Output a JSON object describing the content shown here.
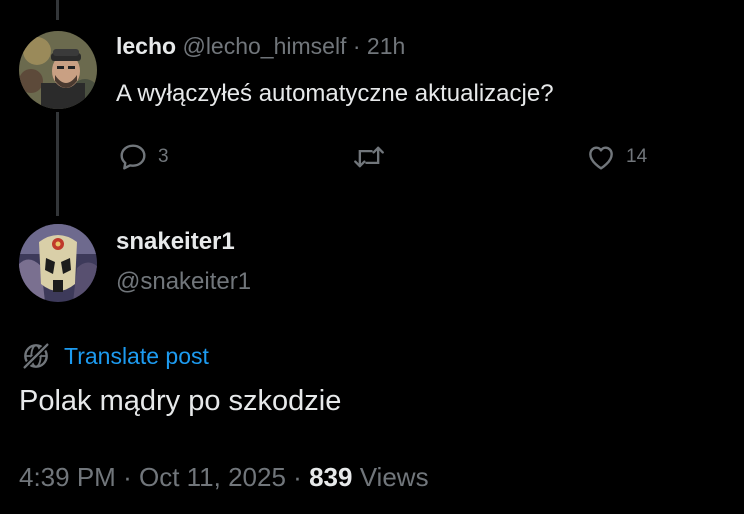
{
  "reply": {
    "display_name": "lecho",
    "handle": "@lecho_himself",
    "separator": "·",
    "time": "21h",
    "text": "A wyłączyłeś automatyczne aktualizacje?",
    "actions": {
      "reply_count": "3",
      "repost_count": "",
      "like_count": "14"
    }
  },
  "post": {
    "display_name": "snakeiter1",
    "handle": "@snakeiter1",
    "translate_label": "Translate post",
    "text": "Polak mądry po szkodzie",
    "time": "4:39 PM",
    "separator": "·",
    "date": "Oct 11, 2025",
    "separator2": "·",
    "views_count": "839",
    "views_label": "Views"
  },
  "colors": {
    "background": "#000000",
    "primary_text": "#e7e9ea",
    "secondary_text": "#71767b",
    "link": "#1d9bf0",
    "thread_line": "#333639"
  },
  "icons": {
    "reply": "speech-bubble-icon",
    "repost": "repost-arrows-icon",
    "like": "heart-icon",
    "translate": "globe-slash-icon"
  }
}
